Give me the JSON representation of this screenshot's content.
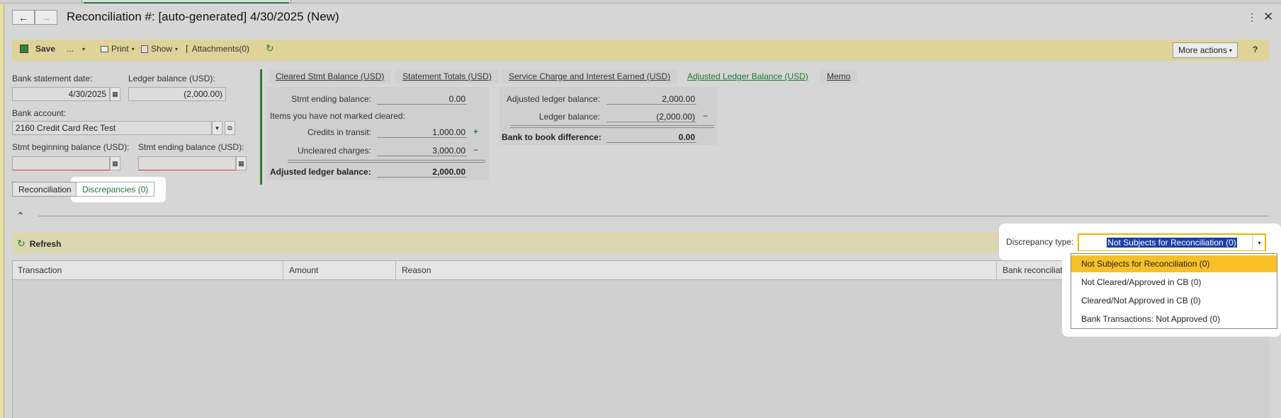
{
  "window": {
    "title": "Reconciliation #: [auto-generated] 4/30/2025 (New)",
    "back_icon": "arrow-left-icon",
    "forward_icon": "arrow-right-icon"
  },
  "toolbar": {
    "save": "Save",
    "dots": "...",
    "print": "Print",
    "show": "Show",
    "attachments": "Attachments(0)",
    "more_actions": "More actions",
    "help": "?"
  },
  "form": {
    "bank_statement_date_label": "Bank statement date:",
    "bank_statement_date": "4/30/2025",
    "ledger_balance_label": "Ledger balance (USD):",
    "ledger_balance": "(2,000.00)",
    "bank_account_label": "Bank account:",
    "bank_account": "2160 Credit Card Rec Test",
    "stmt_beginning_label": "Stmt beginning balance (USD):",
    "stmt_beginning": "",
    "stmt_ending_label": "Stmt ending balance (USD):",
    "stmt_ending": ""
  },
  "summary_tabs": [
    "Cleared Stmt Balance (USD)",
    "Statement Totals (USD)",
    "Service Charge and Interest Earned (USD)",
    "Adjusted Ledger Balance (USD)",
    "Memo"
  ],
  "summary_left": {
    "stmt_ending_label": "Stmt ending balance:",
    "stmt_ending": "0.00",
    "not_marked_label": "Items you have not marked cleared:",
    "credits_label": "Credits in transit:",
    "credits": "1,000.00",
    "credits_sign": "+",
    "uncleared_label": "Uncleared charges:",
    "uncleared": "3,000.00",
    "uncleared_sign": "−",
    "adjusted_label": "Adjusted ledger balance:",
    "adjusted": "2,000.00"
  },
  "summary_right": {
    "adjusted_label": "Adjusted ledger balance:",
    "adjusted": "2,000.00",
    "ledger_label": "Ledger balance:",
    "ledger": "(2,000.00)",
    "ledger_sign": "−",
    "difference_label": "Bank to book difference:",
    "difference": "0.00"
  },
  "subtabs": {
    "reconciliation": "Reconciliation",
    "discrepancies": "Discrepancies (0)"
  },
  "grid": {
    "refresh": "Refresh",
    "discrepancy_type_label": "Discrepancy type:",
    "discrepancy_type_value": "Not Subjects for Reconciliation (0)",
    "columns": [
      "Transaction",
      "Amount",
      "Reason",
      "Bank reconciliati"
    ],
    "dropdown_options": [
      "Not Subjects for Reconciliation (0)",
      "Not Cleared/Approved in CB (0)",
      "Cleared/Not Approved in CB (0)",
      "Bank Transactions: Not Approved (0)"
    ]
  },
  "colors": {
    "accent_green": "#2e7d32",
    "toolbar_bg": "#e0d399",
    "selected_option": "#f7c028",
    "text_selection": "#1a3fa8"
  }
}
